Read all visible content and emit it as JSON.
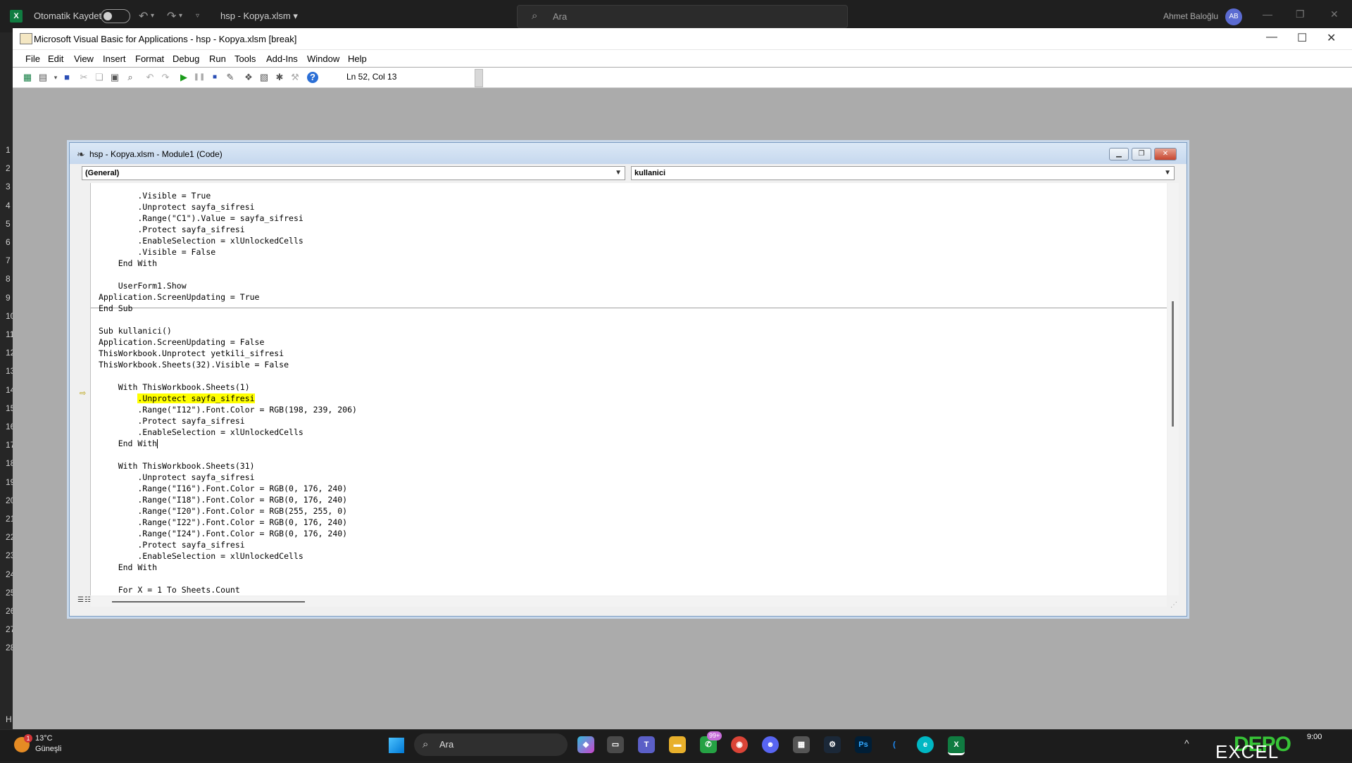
{
  "excel": {
    "autosave_label": "Otomatik Kaydet",
    "file_name": "hsp - Kopya.xlsm",
    "search_placeholder": "Ara",
    "user_name": "Ahmet Baloğlu",
    "user_initials": "AB",
    "row_numbers": [
      "1",
      "2",
      "3",
      "4",
      "5",
      "6",
      "7",
      "8",
      "9",
      "10",
      "11",
      "12",
      "13",
      "14",
      "15",
      "16",
      "17",
      "18",
      "19",
      "20",
      "21",
      "22",
      "23",
      "24",
      "25",
      "26",
      "27",
      "28"
    ],
    "cell_ref_fragment": "H"
  },
  "vbe": {
    "title": "Microsoft Visual Basic for Applications - hsp - Kopya.xlsm [break]",
    "menu": [
      "File",
      "Edit",
      "View",
      "Insert",
      "Format",
      "Debug",
      "Run",
      "Tools",
      "Add-Ins",
      "Window",
      "Help"
    ],
    "status_position": "Ln 52, Col 13",
    "toolbar_icons": [
      "excel-icon",
      "insert-userform-icon",
      "save-icon",
      "cut-icon",
      "copy-icon",
      "paste-icon",
      "find-icon",
      "undo-icon",
      "redo-icon",
      "run-icon",
      "break-icon",
      "reset-icon",
      "design-mode-icon",
      "project-explorer-icon",
      "properties-icon",
      "object-browser-icon",
      "toolbox-icon",
      "help-icon"
    ]
  },
  "code_window": {
    "title": "hsp - Kopya.xlsm - Module1 (Code)",
    "object_combo": "(General)",
    "procedure_combo": "kullanici",
    "lines": [
      "        .Visible = True",
      "        .Unprotect sayfa_sifresi",
      "        .Range(\"C1\").Value = sayfa_sifresi",
      "        .Protect sayfa_sifresi",
      "        .EnableSelection = xlUnlockedCells",
      "        .Visible = False",
      "    End With",
      "",
      "    UserForm1.Show",
      "Application.ScreenUpdating = True",
      "End Sub",
      "",
      "Sub kullanici()",
      "Application.ScreenUpdating = False",
      "ThisWorkbook.Unprotect yetkili_sifresi",
      "ThisWorkbook.Sheets(32).Visible = False",
      "",
      "    With ThisWorkbook.Sheets(1)",
      "        .Unprotect sayfa_sifresi",
      "        .Range(\"I12\").Font.Color = RGB(198, 239, 206)",
      "        .Protect sayfa_sifresi",
      "        .EnableSelection = xlUnlockedCells",
      "    End With",
      "",
      "    With ThisWorkbook.Sheets(31)",
      "        .Unprotect sayfa_sifresi",
      "        .Range(\"I16\").Font.Color = RGB(0, 176, 240)",
      "        .Range(\"I18\").Font.Color = RGB(0, 176, 240)",
      "        .Range(\"I20\").Font.Color = RGB(255, 255, 0)",
      "        .Range(\"I22\").Font.Color = RGB(0, 176, 240)",
      "        .Range(\"I24\").Font.Color = RGB(0, 176, 240)",
      "        .Protect sayfa_sifresi",
      "        .EnableSelection = xlUnlockedCells",
      "    End With",
      "",
      "    For X = 1 To Sheets.Count"
    ],
    "highlight_line_index": 18,
    "highlight_indent": "        ",
    "highlight_text": ".Unprotect sayfa_sifresi",
    "cursor_line_index": 22,
    "highlight_color": "#ffff00"
  },
  "taskbar": {
    "temperature": "13°C",
    "condition": "Güneşli",
    "weather_badge": "1",
    "search_placeholder": "Ara",
    "whatsapp_badge": "99+",
    "tray_logo": "DEPO",
    "tray_brand": "EXCEL",
    "time": "9:00"
  },
  "colors": {
    "vbe_background": "#ababab",
    "excel_green": "#107c41",
    "highlight": "#ffff00"
  }
}
